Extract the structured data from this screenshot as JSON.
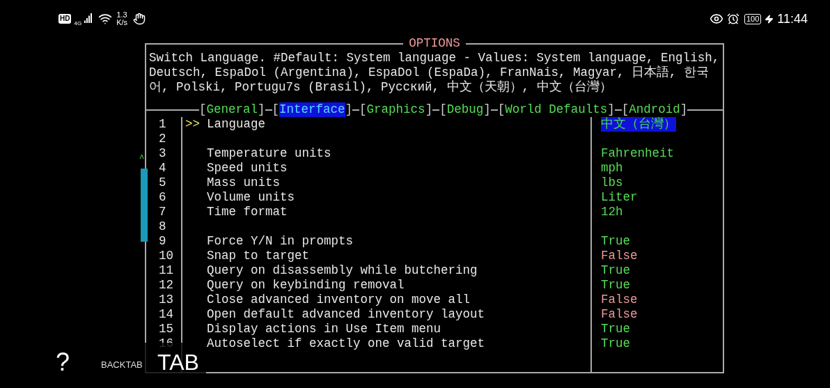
{
  "status_bar": {
    "left_badges": [
      "HD",
      "4G"
    ],
    "speed": "1.3",
    "speed_unit": "K/s",
    "battery": "100",
    "time": "11:44"
  },
  "window": {
    "title": "OPTIONS"
  },
  "description": "Switch Language. #Default: System language - Values: System language, English, Deutsch, EspaDol (Argentina), EspaDol (EspaDa), FranNais, Magyar, 日本語, 한국어, Polski, Portugu7s (Brasil), Русский, 中文（天朝）, 中文（台灣）",
  "tabs": [
    {
      "open": "[",
      "label": "General",
      "close": "]",
      "selected": false
    },
    {
      "open": "[",
      "label": "Interface",
      "close": "]",
      "selected": true
    },
    {
      "open": "[",
      "label": "Graphics",
      "close": "]",
      "selected": false
    },
    {
      "open": "[",
      "label": "Debug",
      "close": "]",
      "selected": false
    },
    {
      "open": "[",
      "label": "World Defaults",
      "close": "]",
      "selected": false
    },
    {
      "open": "[",
      "label": "Android",
      "close": "]",
      "selected": false
    }
  ],
  "cursor": ">>",
  "scroll_marker": "^",
  "rows": [
    {
      "number": "1",
      "label": "Language",
      "value": "中文（台灣）",
      "selected": true
    },
    {
      "number": "2",
      "selected": false
    },
    {
      "number": "3",
      "label": "Temperature units",
      "value": "Fahrenheit",
      "color": "#55dd55",
      "selected": false
    },
    {
      "number": "4",
      "label": "Speed units",
      "value": "mph",
      "color": "#55dd55",
      "selected": false
    },
    {
      "number": "5",
      "label": "Mass units",
      "value": "lbs",
      "color": "#55dd55",
      "selected": false
    },
    {
      "number": "6",
      "label": "Volume units",
      "value": "Liter",
      "color": "#55dd55",
      "selected": false
    },
    {
      "number": "7",
      "label": "Time format",
      "value": "12h",
      "color": "#55dd55",
      "selected": false
    },
    {
      "number": "8",
      "selected": false
    },
    {
      "number": "9",
      "label": "Force Y/N in prompts",
      "value": "True",
      "color": "#55dd55",
      "selected": false
    },
    {
      "number": "10",
      "label": "Snap to target",
      "value": "False",
      "color": "#ee9999",
      "selected": false
    },
    {
      "number": "11",
      "label": "Query on disassembly while butchering",
      "value": "True",
      "color": "#55dd55",
      "selected": false
    },
    {
      "number": "12",
      "label": "Query on keybinding removal",
      "value": "True",
      "color": "#55dd55",
      "selected": false
    },
    {
      "number": "13",
      "label": "Close advanced inventory on move all",
      "value": "False",
      "color": "#ee9999",
      "selected": false
    },
    {
      "number": "14",
      "label": "Open default advanced inventory layout",
      "value": "False",
      "color": "#ee9999",
      "selected": false
    },
    {
      "number": "15",
      "label": "Display actions in Use Item menu",
      "value": "True",
      "color": "#55dd55",
      "selected": false
    },
    {
      "number": "16",
      "label": "Autoselect if exactly one valid target",
      "value": "True",
      "color": "#55dd55",
      "selected": false
    }
  ],
  "overlay_buttons": {
    "help": "?",
    "backtab": "BACKTAB",
    "tab": "TAB"
  }
}
